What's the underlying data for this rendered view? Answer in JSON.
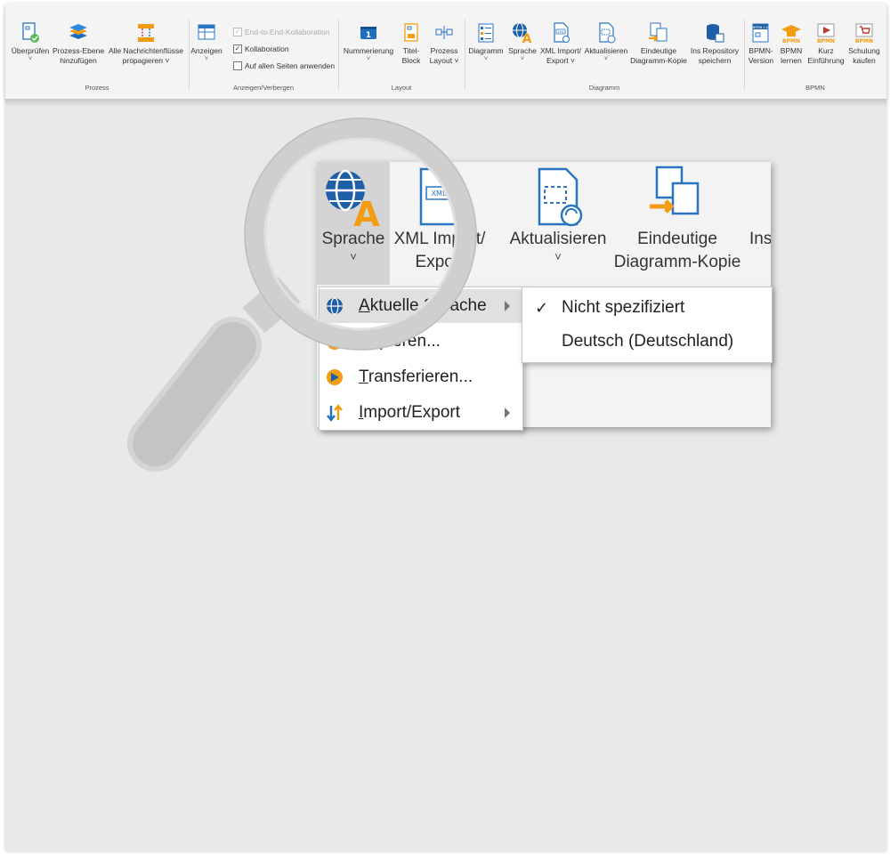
{
  "ribbon": {
    "groups": {
      "prozess": "Prozess",
      "anzeigen": "Anzeigen/Verbergen",
      "layout": "Layout",
      "diagramm": "Diagramm",
      "bpmn": "BPMN"
    },
    "buttons": {
      "ueberpruefen": "Überprüfen",
      "prozess_ebene": "Prozess-Ebene\nhinzufügen",
      "nachrichtenfluesse": "Alle Nachrichtenflüsse\npropagieren ˅",
      "anzeigen": "Anzeigen",
      "nummerierung": "Nummerierung",
      "titel_block": "Titel-\nBlock",
      "prozess_layout": "Prozess\nLayout ˅",
      "diagramm": "Diagramm",
      "sprache": "Sprache",
      "xml_import": "XML Import/\nExport ˅",
      "aktualisieren": "Aktualisieren",
      "eindeutige": "Eindeutige\nDiagramm-Kopie",
      "ins_repository": "Ins Repository\nspeichern",
      "bpmn_version": "BPMN-\nVersion",
      "bpmn_lernen": "BPMN\nlernen",
      "kurz_einfuehrung": "Kurz\nEinführung",
      "schulung": "Schulung\nkaufen"
    },
    "checkboxes": {
      "end_to_end": "End-to-End-Kollaboration",
      "kollaboration": "Kollaboration",
      "auf_allen_seiten": "Auf allen Seiten anwenden"
    },
    "bpmn_badge": "BPMN",
    "bpmn_version_badge": "BPMN 2.0",
    "xml_badge": "XML",
    "numbering_badge": "1"
  },
  "zoom": {
    "sprache": "Sprache",
    "xml_import_line1": "XML Import/",
    "xml_import_line2": "Export",
    "aktualisieren": "Aktualisieren",
    "eindeutige_line1": "Eindeutige",
    "eindeutige_line2": "Diagramm-Kopie",
    "ins": "Ins",
    "xml_badge": "XML"
  },
  "menu": {
    "items": [
      {
        "label": "Aktuelle Sprache",
        "accel": "A",
        "rest": "ktuelle Sprache"
      },
      {
        "label": "Kopieren...",
        "accel": "K",
        "rest": "opieren..."
      },
      {
        "label": "Transferieren...",
        "accel": "T",
        "rest": "ransferieren..."
      },
      {
        "label": "Import/Export",
        "accel": "I",
        "rest": "mport/Export"
      }
    ]
  },
  "submenu": {
    "items": [
      {
        "label": "Nicht spezifiziert",
        "checked": true,
        "check_glyph": "✓"
      },
      {
        "label": "Deutsch (Deutschland)",
        "checked": false
      }
    ]
  },
  "colors": {
    "accent_blue": "#1e6fc0",
    "accent_orange": "#f39c12",
    "bpmn_red": "#c0392b",
    "lens_grey": "#c8c8c8"
  }
}
